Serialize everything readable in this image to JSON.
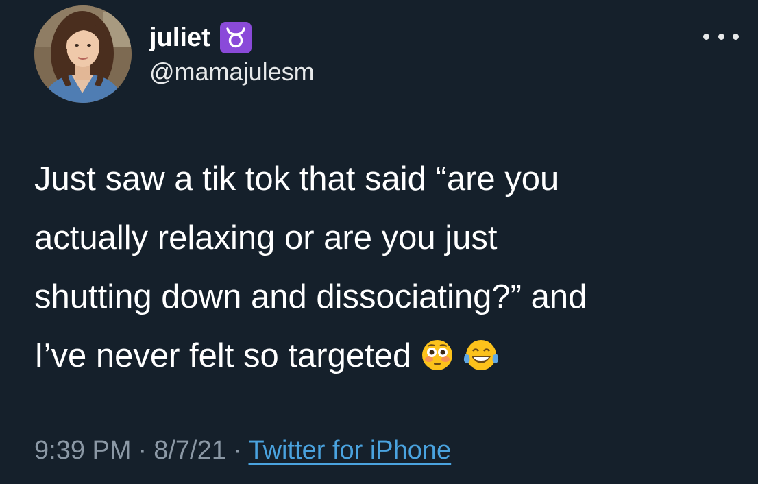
{
  "user": {
    "display_name": "juliet",
    "zodiac_badge": "taurus-icon",
    "handle": "@mamajulesm"
  },
  "tweet": {
    "lines": [
      "Just saw a tik tok that said “are you",
      "actually relaxing or are you just",
      "shutting down and dissociating?” and",
      "I’ve never felt so targeted"
    ],
    "emojis": [
      "flushed-face-icon",
      "face-with-tears-of-joy-icon"
    ]
  },
  "meta": {
    "time": "9:39 PM",
    "separator": "·",
    "date": "8/7/21",
    "source": "Twitter for iPhone"
  },
  "colors": {
    "background": "#15202b",
    "text": "#ffffff",
    "secondary_text": "#8b98a5",
    "link": "#4aa3df",
    "badge": "#8a4ad9"
  }
}
